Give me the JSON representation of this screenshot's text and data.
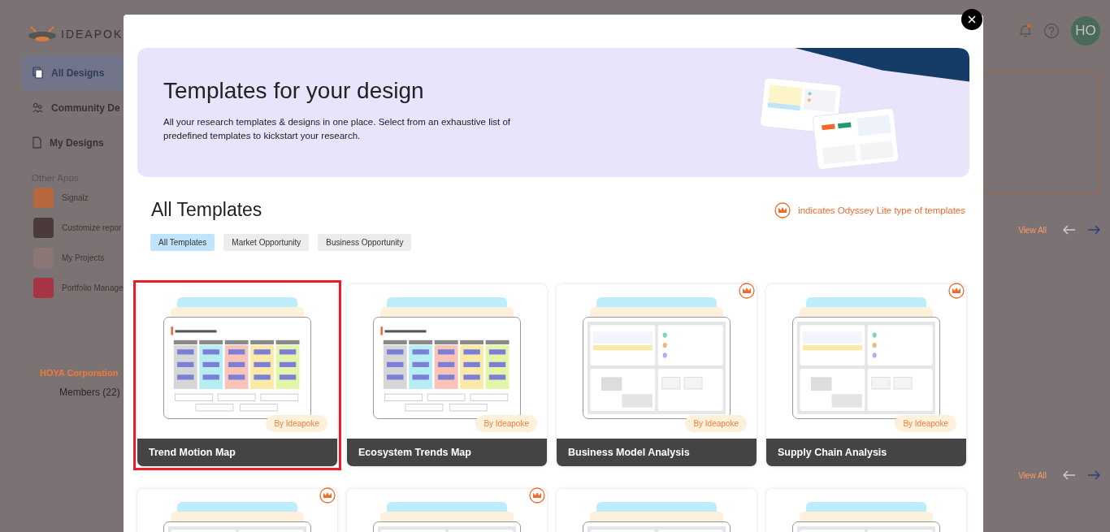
{
  "background": {
    "logo": {
      "name": "IDEAPOK"
    },
    "nav": [
      {
        "label": "All Designs",
        "selected": true,
        "kind": "copy"
      },
      {
        "label": "Community De",
        "selected": false,
        "kind": "people"
      },
      {
        "label": "My Designs",
        "selected": false,
        "kind": "document"
      }
    ],
    "other_apps_heading": "Other Apps",
    "other_apps": [
      {
        "label": "Signalz",
        "color": "#b8683f"
      },
      {
        "label": "Customize repor",
        "color": "#4a3a3a"
      },
      {
        "label": "My Projects",
        "color": "#8c7777"
      },
      {
        "label": "Portfolio Manage",
        "color": "#a63444"
      }
    ],
    "organization": "HOYA Corporation",
    "members": "Members (22)",
    "avatar": "HO",
    "sections": [
      {
        "link": "View All"
      },
      {
        "link": "View All"
      }
    ]
  },
  "modal": {
    "banner": {
      "title": "Templates for your design",
      "description": "All your research templates & designs in one place. Select from an exhaustive list of predefined templates to kickstart your research."
    },
    "heading": "All Templates",
    "legend": "indicates Odyssey Lite type of templates",
    "filters": [
      {
        "label": "All Templates",
        "selected": true
      },
      {
        "label": "Market Opportunity",
        "selected": false
      },
      {
        "label": "Business Opportunity",
        "selected": false
      }
    ],
    "cards": [
      {
        "title": "Trend Motion Map",
        "badge": "By Ideapoke",
        "premium": false,
        "selected": true,
        "kind": "columns"
      },
      {
        "title": "Ecosystem Trends Map",
        "badge": "By Ideapoke",
        "premium": false,
        "selected": false,
        "kind": "columns"
      },
      {
        "title": "Business Model Analysis",
        "badge": "By Ideapoke",
        "premium": true,
        "selected": false,
        "kind": "panels"
      },
      {
        "title": "Supply Chain Analysis",
        "badge": "By Ideapoke",
        "premium": true,
        "selected": false,
        "kind": "panels"
      },
      {
        "premium": true,
        "selected": false,
        "kind": "panels"
      },
      {
        "premium": true,
        "selected": false,
        "kind": "panels"
      },
      {
        "premium": false,
        "selected": false,
        "kind": "panels"
      },
      {
        "premium": false,
        "selected": false,
        "kind": "panels"
      }
    ]
  }
}
